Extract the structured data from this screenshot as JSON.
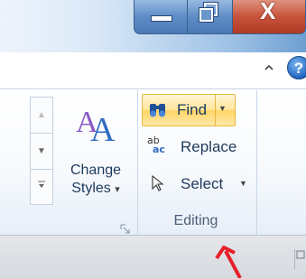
{
  "window": {
    "controls": {
      "minimize_icon": "minimize-icon",
      "maximize_icon": "restore-icon",
      "close_glyph": "X"
    }
  },
  "ribbon": {
    "help_glyph": "?",
    "collapse_glyph": "^",
    "styles_group": {
      "change_styles_label_line1": "Change",
      "change_styles_label_line2": "Styles",
      "dropdown_glyph": "▾",
      "styles_icon_letters": "AA"
    },
    "editing_group": {
      "label": "Editing",
      "find_label": "Find",
      "replace_label": "Replace",
      "select_label": "Select",
      "replace_icon_text_top": "ab",
      "replace_icon_text_bottom": "ac"
    }
  },
  "colors": {
    "ribbon_text": "#1e395b",
    "find_hover_bg": "#ffe59a",
    "close_red": "#c8543d",
    "annotation_arrow": "#e8202a"
  }
}
